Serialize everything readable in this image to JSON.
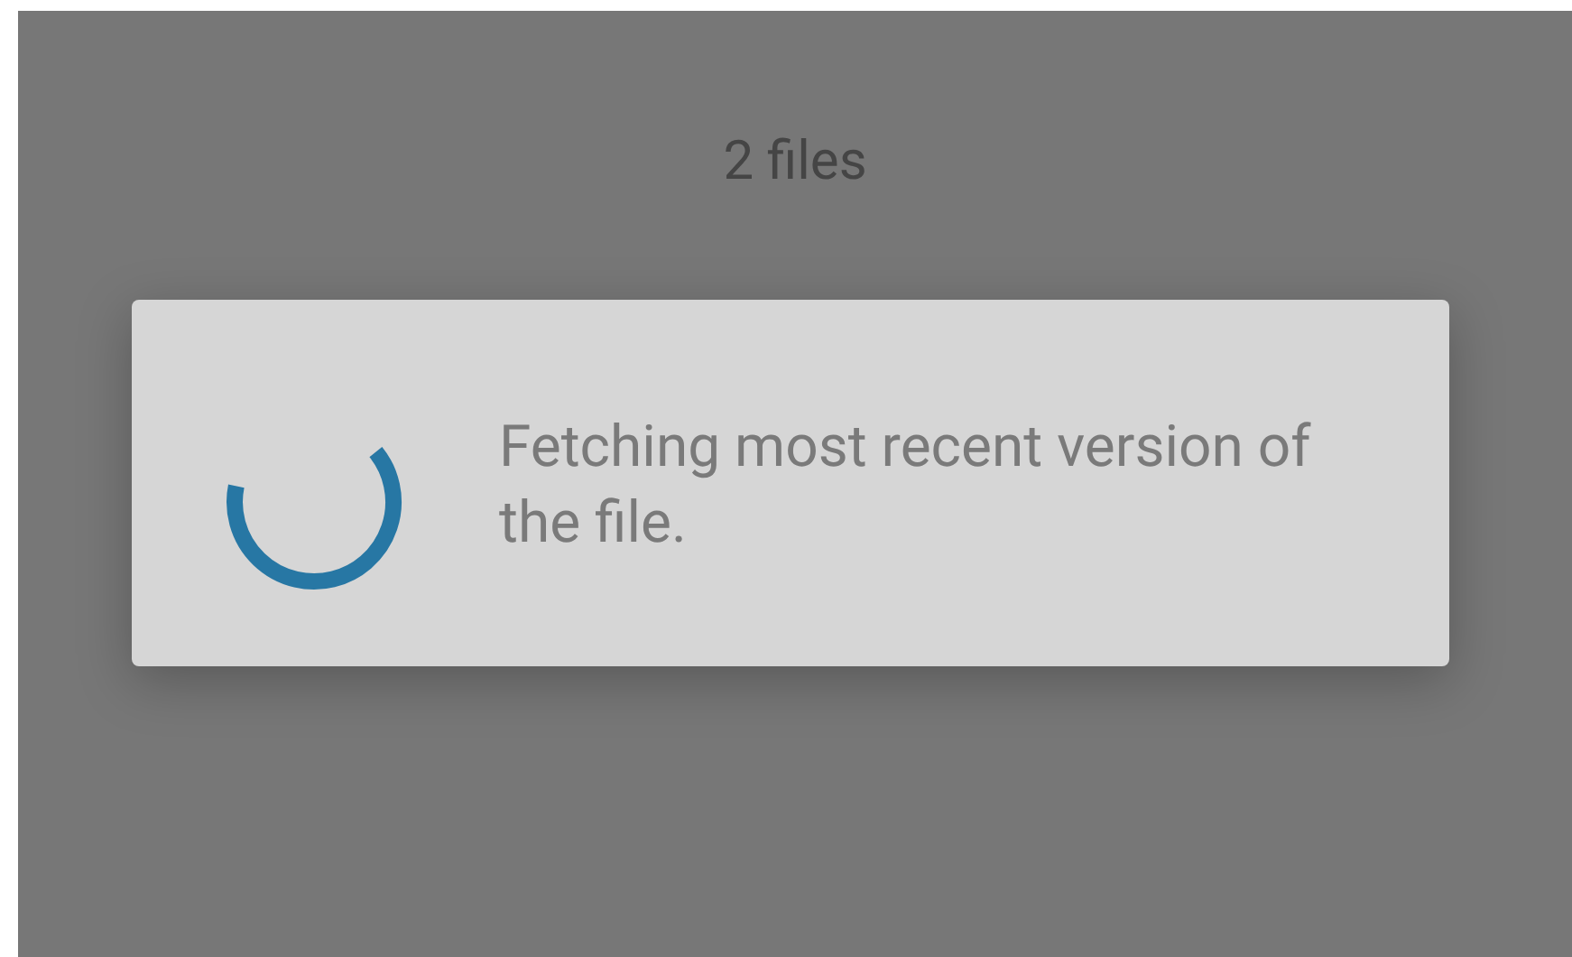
{
  "header": {
    "title": "2 files"
  },
  "dialog": {
    "message": "Fetching most recent version of the file."
  }
}
